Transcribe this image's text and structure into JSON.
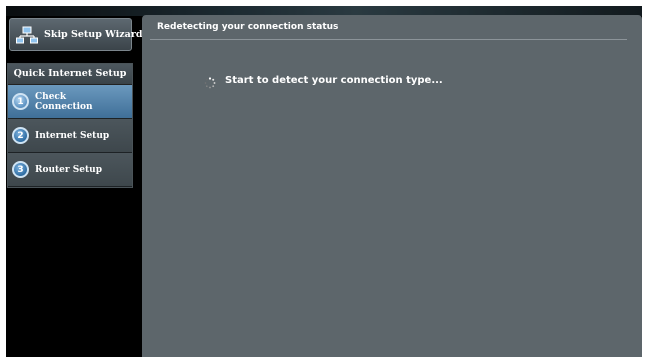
{
  "sidebar": {
    "skip_button_label": "Skip Setup Wizard",
    "skip_icon": "network-icon",
    "panel_title": "Quick Internet Setup",
    "steps": [
      {
        "number": "1",
        "label": "Check Connection",
        "active": true
      },
      {
        "number": "2",
        "label": "Internet Setup",
        "active": false
      },
      {
        "number": "3",
        "label": "Router Setup",
        "active": false
      }
    ]
  },
  "main": {
    "title": "Redetecting your connection status",
    "status_icon": "loading-spinner-icon",
    "status_text": "Start to detect your connection type..."
  },
  "colors": {
    "background": "#000000",
    "main_panel": "#5d666b",
    "active_step": "#4f82ad",
    "text": "#ffffff"
  }
}
